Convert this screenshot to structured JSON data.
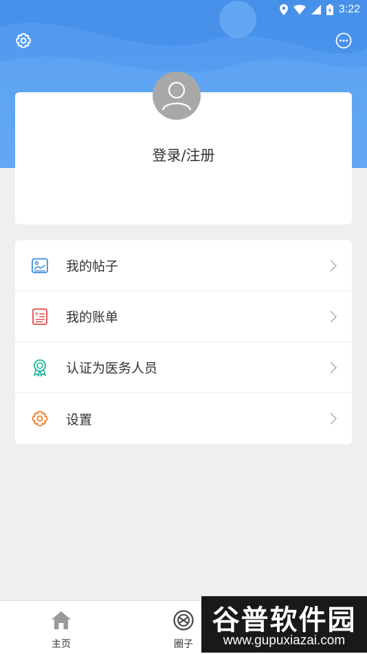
{
  "status_bar": {
    "time": "3:22"
  },
  "header": {
    "settings_icon": "gear-icon",
    "message_icon": "chat-icon"
  },
  "profile": {
    "login_label": "登录/注册",
    "avatar_icon": "user-avatar-icon"
  },
  "menu": [
    {
      "label": "我的帖子",
      "icon": "image-post-icon",
      "color": "#3d8fe0"
    },
    {
      "label": "我的账单",
      "icon": "bill-icon",
      "color": "#e04a4a"
    },
    {
      "label": "认证为医务人员",
      "icon": "badge-icon",
      "color": "#1ab394"
    },
    {
      "label": "设置",
      "icon": "gear-icon",
      "color": "#f07a2a"
    }
  ],
  "tabbar": [
    {
      "label": "主页",
      "icon": "home-icon"
    },
    {
      "label": "圈子",
      "icon": "circle-icon"
    }
  ],
  "watermark": {
    "title": "谷普软件园",
    "url": "www.gupuxiazai.com"
  },
  "colors": {
    "header_blue": "#4f98ee",
    "background": "#efeff1"
  }
}
